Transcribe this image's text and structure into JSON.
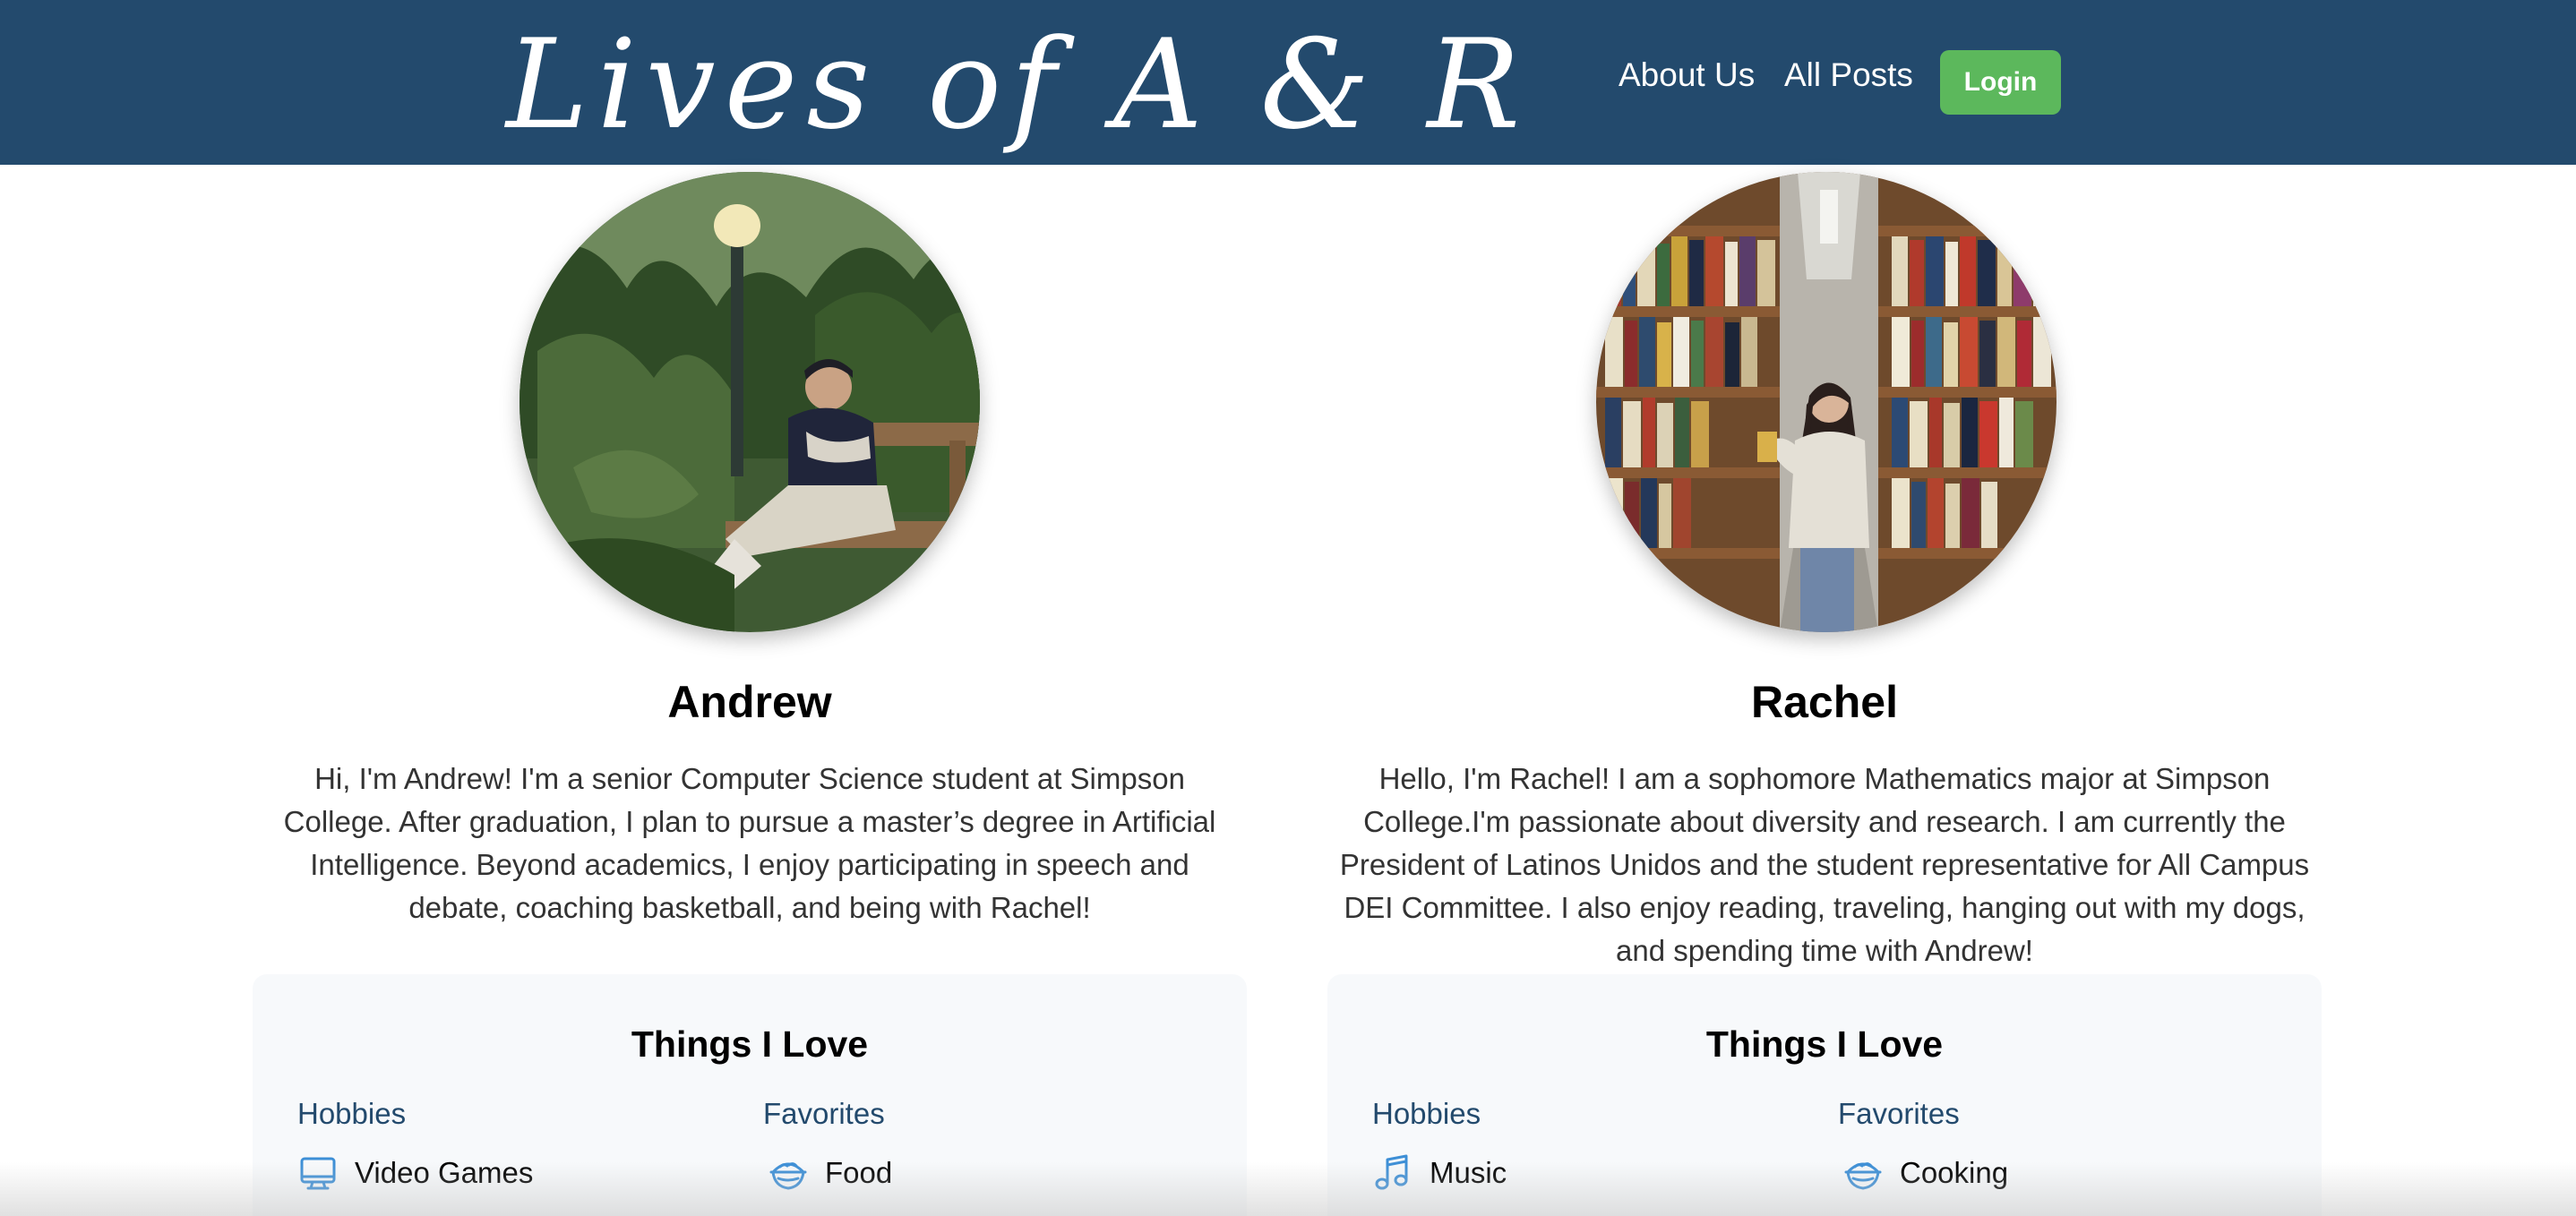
{
  "header": {
    "brand": "Lives of A & R",
    "nav": {
      "about": "About Us",
      "posts": "All Posts",
      "login": "Login"
    }
  },
  "profiles": [
    {
      "name": "Andrew",
      "bio": "Hi, I'm Andrew! I'm a senior Computer Science student at Simpson College. After graduation, I plan to pursue a master’s degree in Artificial Intelligence. Beyond academics, I enjoy participating in speech and debate, coaching basketball, and being with Rachel!",
      "love_title": "Things I Love",
      "hobbies_title": "Hobbies",
      "favorites_title": "Favorites",
      "hobby_item": {
        "icon": "monitor-icon",
        "label": "Video Games"
      },
      "favorite_item": {
        "icon": "food-bowl-icon",
        "label": "Food"
      }
    },
    {
      "name": "Rachel",
      "bio": "Hello, I'm Rachel! I am a sophomore Mathematics major at Simpson College.I'm passionate about diversity and research. I am currently the President of Latinos Unidos and the student representative for All Campus DEI Committee. I also enjoy reading, traveling, hanging out with my dogs, and spending time with Andrew!",
      "love_title": "Things I Love",
      "hobbies_title": "Hobbies",
      "favorites_title": "Favorites",
      "hobby_item": {
        "icon": "music-note-icon",
        "label": "Music"
      },
      "favorite_item": {
        "icon": "food-bowl-icon",
        "label": "Cooking"
      }
    }
  ],
  "colors": {
    "header_bg": "#234a6d",
    "login_bg": "#5cb85c",
    "accent_text": "#234a6d",
    "icon_blue": "#3d8fd6",
    "card_bg": "#f7f9fb"
  }
}
